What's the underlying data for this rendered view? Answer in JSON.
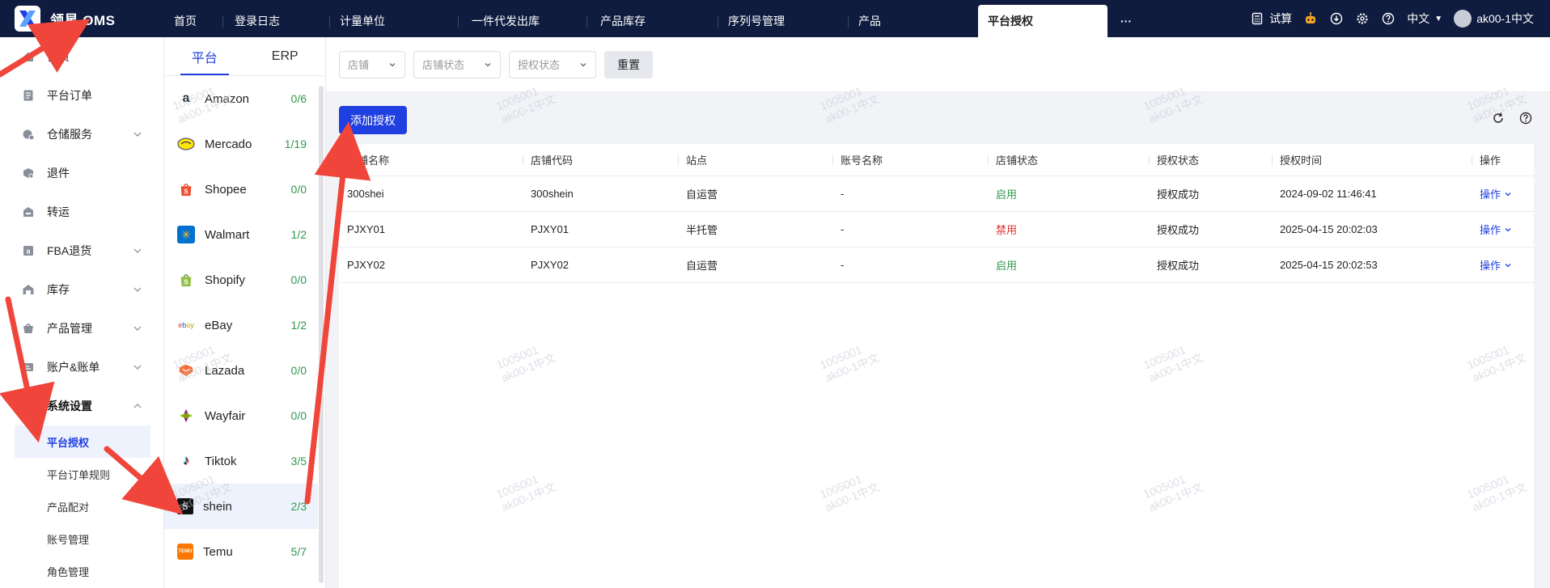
{
  "app": {
    "title": "领星 OMS"
  },
  "topnav": {
    "tabs": [
      {
        "label": "首页"
      },
      {
        "label": "登录日志"
      },
      {
        "label": "计量单位"
      },
      {
        "label": "一件代发出库"
      },
      {
        "label": "产品库存"
      },
      {
        "label": "序列号管理"
      },
      {
        "label": "产品"
      },
      {
        "label": "平台授权",
        "active": true
      }
    ],
    "more": "···",
    "calc_label": "试算",
    "lang": "中文",
    "user": "ak00-1中文"
  },
  "sidebar": {
    "items": [
      {
        "label": "首页",
        "icon": "home-icon"
      },
      {
        "label": "平台订单",
        "icon": "order-icon"
      },
      {
        "label": "仓储服务",
        "icon": "warehouse-icon",
        "expandable": true
      },
      {
        "label": "退件",
        "icon": "return-icon"
      },
      {
        "label": "转运",
        "icon": "transfer-icon"
      },
      {
        "label": "FBA退货",
        "icon": "fba-icon",
        "expandable": true
      },
      {
        "label": "库存",
        "icon": "inventory-icon",
        "expandable": true
      },
      {
        "label": "产品管理",
        "icon": "product-icon",
        "expandable": true
      },
      {
        "label": "账户&账单",
        "icon": "account-icon",
        "expandable": true
      },
      {
        "label": "系统设置",
        "icon": "settings-icon",
        "expanded": true
      }
    ],
    "sub_items": [
      {
        "label": "平台授权",
        "active": true
      },
      {
        "label": "平台订单规则"
      },
      {
        "label": "产品配对"
      },
      {
        "label": "账号管理"
      },
      {
        "label": "角色管理"
      }
    ]
  },
  "platforms": {
    "tabs": [
      "平台",
      "ERP"
    ],
    "list": [
      {
        "name": "Amazon",
        "count": "0/6",
        "logo_color": "#232f3e",
        "logo_text": "a"
      },
      {
        "name": "Mercado",
        "count": "1/19",
        "logo_color": "#ffe600",
        "logo_text": "M"
      },
      {
        "name": "Shopee",
        "count": "0/0",
        "logo_color": "#ee4d2d",
        "logo_text": "S"
      },
      {
        "name": "Walmart",
        "count": "1/2",
        "logo_color": "#0071ce",
        "logo_text": "✳"
      },
      {
        "name": "Shopify",
        "count": "0/0",
        "logo_color": "#95bf47",
        "logo_text": "S"
      },
      {
        "name": "eBay",
        "count": "1/2",
        "logo_color": "#e53238",
        "logo_text": "ebay"
      },
      {
        "name": "Lazada",
        "count": "0/0",
        "logo_color": "#f36e3a",
        "logo_text": "♥"
      },
      {
        "name": "Wayfair",
        "count": "0/0",
        "logo_color": "#7f187f",
        "logo_text": "✦"
      },
      {
        "name": "Tiktok",
        "count": "3/5",
        "logo_color": "#111111",
        "logo_text": "♪"
      },
      {
        "name": "shein",
        "count": "2/3",
        "logo_color": "#111111",
        "logo_text": "S",
        "active": true
      },
      {
        "name": "Temu",
        "count": "5/7",
        "logo_color": "#fb7701",
        "logo_text": "TEMU"
      }
    ]
  },
  "filters": {
    "store_placeholder": "店铺",
    "store_status_placeholder": "店铺状态",
    "auth_status_placeholder": "授权状态",
    "reset_label": "重置"
  },
  "actions": {
    "add_label": "添加授权"
  },
  "table": {
    "headers": [
      "店铺名称",
      "店铺代码",
      "站点",
      "账号名称",
      "店铺状态",
      "授权状态",
      "授权时间",
      "操作"
    ],
    "rows": [
      {
        "store_name": "300shei",
        "store_code": "300shein",
        "site": "自运营",
        "account": "-",
        "store_status": "启用",
        "auth_status": "授权成功",
        "auth_time": "2024-09-02 11:46:41",
        "op": "操作"
      },
      {
        "store_name": "PJXY01",
        "store_code": "PJXY01",
        "site": "半托管",
        "account": "-",
        "store_status": "禁用",
        "auth_status": "授权成功",
        "auth_time": "2025-04-15 20:02:03",
        "op": "操作"
      },
      {
        "store_name": "PJXY02",
        "store_code": "PJXY02",
        "site": "自运营",
        "account": "-",
        "store_status": "启用",
        "auth_status": "授权成功",
        "auth_time": "2025-04-15 20:02:53",
        "op": "操作"
      }
    ]
  },
  "watermark": {
    "line1": "1005001",
    "line2": "ak00-1中文"
  },
  "colors": {
    "topbar": "#0f1c3f",
    "accent": "#1f3fe0",
    "status_on": "#2f9a4a",
    "status_off": "#e02d2d",
    "annotation": "#f0453a"
  }
}
